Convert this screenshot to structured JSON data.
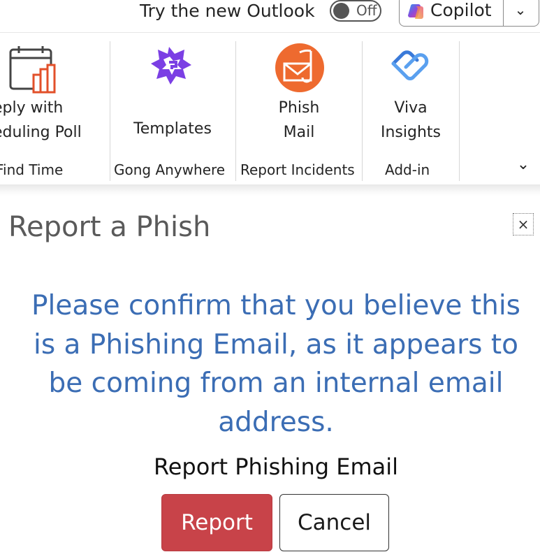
{
  "topbar": {
    "try_label": "Try the new Outlook",
    "toggle_state": "Off",
    "copilot_label": "Copilot"
  },
  "ribbon": {
    "groups": [
      {
        "button_label_line1": "eply with",
        "button_label_line2": "eduling Poll",
        "group_name": "Find Time",
        "icon": "calendar-chart-icon"
      },
      {
        "button_label_line1": "Templates",
        "group_name": "Gong Anywhere",
        "icon": "gong-templates-icon"
      },
      {
        "button_label_line1": "Phish",
        "button_label_line2": "Mail",
        "group_name": "Report Incidents",
        "icon": "phish-mail-icon"
      },
      {
        "button_label_line1": "Viva",
        "button_label_line2": "Insights",
        "group_name": "Add-in",
        "icon": "viva-insights-icon"
      }
    ]
  },
  "dialog": {
    "title": "Report a Phish",
    "close_label": "×",
    "message": "Please confirm that you believe this is a Phishing Email, as it appears to be coming from an internal email address.",
    "subheading": "Report Phishing Email",
    "report_label": "Report",
    "cancel_label": "Cancel"
  },
  "colors": {
    "message_text": "#3b6db4",
    "report_button": "#c84349",
    "phish_icon": "#ee6a2f",
    "templates_icon": "#7b3fe4",
    "viva_icon": "#3a7ad9"
  }
}
